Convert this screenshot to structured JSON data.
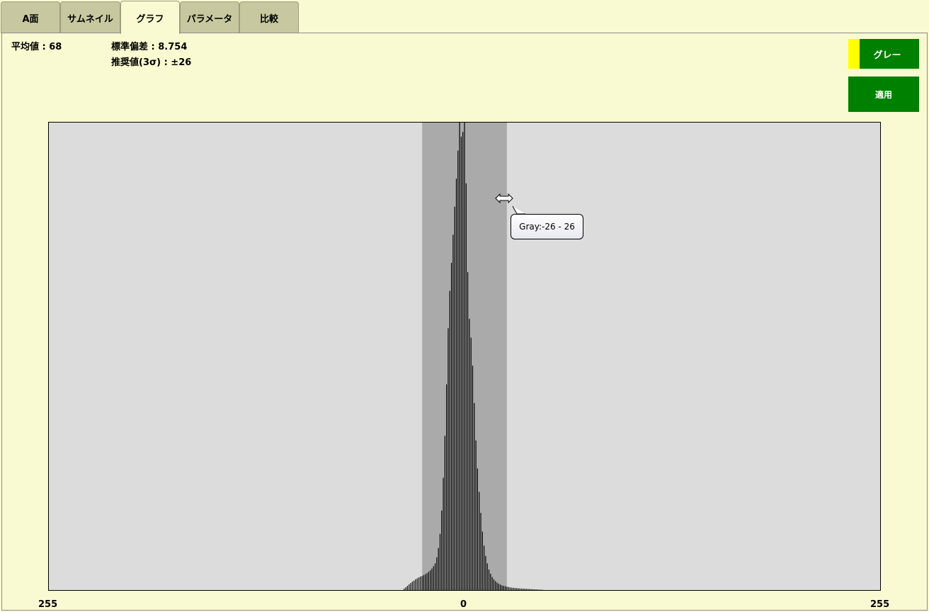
{
  "tabs": [
    {
      "label": "A面",
      "active": false
    },
    {
      "label": "サムネイル",
      "active": false
    },
    {
      "label": "グラフ",
      "active": true
    },
    {
      "label": "パラメータ",
      "active": false
    },
    {
      "label": "比較",
      "active": false
    }
  ],
  "stats": {
    "mean": "平均値 : 68",
    "stddev": "標準偏差 : 8.754",
    "recommended": "推奨値(3σ) : ±26"
  },
  "buttons": {
    "channel": "グレー",
    "apply": "適用"
  },
  "colors": {
    "background": "#fafad2",
    "tab_inactive": "#c8c8a0",
    "button_green": "#008000",
    "channel_swatch": "#ffff00",
    "plot_background": "#dcdcdc",
    "selection_band": "#aaaaaa",
    "bars": "#000000"
  },
  "tooltip": "Gray:-26 - 26",
  "cursor_icon": "horizontal-resize-icon",
  "chart_data": {
    "type": "bar",
    "x_ticks": [
      "255",
      "0",
      "255"
    ],
    "xlim": [
      -255,
      255
    ],
    "selected_range": [
      -26,
      26
    ],
    "grid": false,
    "x": [
      -37,
      -36,
      -35,
      -34,
      -33,
      -32,
      -31,
      -30,
      -29,
      -28,
      -27,
      -26,
      -25,
      -24,
      -23,
      -22,
      -21,
      -20,
      -19,
      -18,
      -17,
      -16,
      -15,
      -14,
      -13,
      -12,
      -11,
      -10,
      -9,
      -8,
      -7,
      -6,
      -5,
      -4,
      -3,
      -2,
      -1,
      0,
      1,
      2,
      3,
      4,
      5,
      6,
      7,
      8,
      9,
      10,
      11,
      12,
      13,
      14,
      15,
      16,
      17,
      18,
      19,
      20,
      21,
      22,
      23,
      24,
      25,
      26,
      27,
      28,
      29,
      30,
      31,
      32,
      33,
      34,
      35,
      36,
      37,
      38,
      39,
      40,
      41,
      42,
      43,
      44,
      45,
      46,
      47,
      48
    ],
    "values": [
      0.3,
      0.6,
      0.9,
      1.2,
      1.5,
      1.8,
      2.0,
      2.3,
      2.5,
      2.7,
      2.9,
      3.0,
      3.2,
      3.4,
      3.6,
      3.9,
      4.2,
      4.6,
      5.1,
      5.7,
      7.0,
      9.0,
      12.0,
      17.0,
      24.0,
      33.0,
      44.0,
      56.0,
      64.0,
      70.0,
      76.0,
      82.0,
      88.0,
      94.0,
      100.0,
      97.0,
      98.0,
      100.0,
      87.0,
      68.0,
      58.0,
      54.0,
      48.0,
      40.0,
      32.0,
      26.0,
      21.0,
      16.5,
      12.5,
      9.5,
      7.3,
      5.7,
      4.4,
      3.5,
      2.8,
      2.3,
      1.9,
      1.6,
      1.35,
      1.15,
      1.0,
      0.9,
      0.8,
      0.72,
      0.65,
      0.58,
      0.52,
      0.47,
      0.43,
      0.4,
      0.37,
      0.34,
      0.31,
      0.29,
      0.27,
      0.25,
      0.23,
      0.21,
      0.19,
      0.17,
      0.15,
      0.13,
      0.11,
      0.09,
      0.07,
      0.05
    ],
    "ylim": [
      0,
      100
    ]
  }
}
